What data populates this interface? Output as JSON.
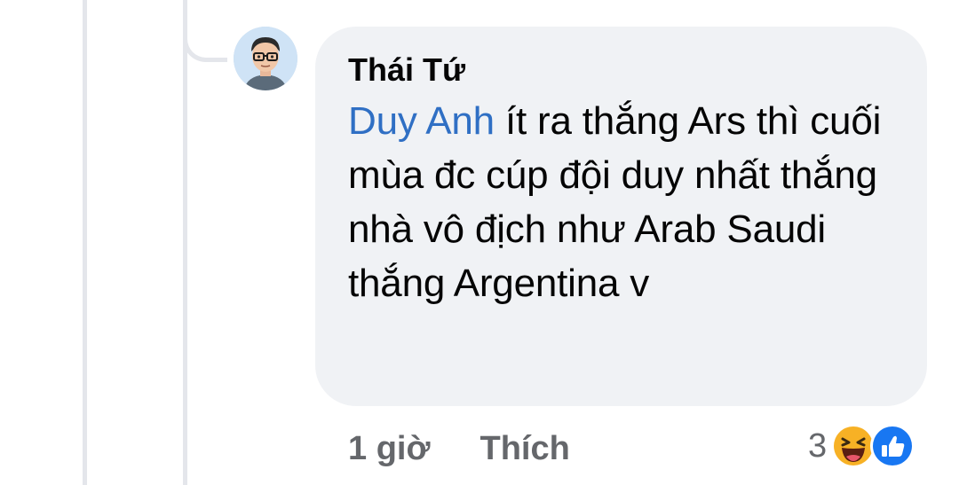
{
  "comment": {
    "author": "Thái Tứ",
    "mention": "Duy Anh",
    "text": " ít ra thắng Ars thì cuối mùa đc cúp đội duy nhất thắng nhà vô địch như Arab Saudi thắng Argentina v",
    "time": "1 giờ",
    "like_label": "Thích",
    "reaction_count": "3",
    "reaction_icons": [
      "haha-icon",
      "like-icon"
    ]
  },
  "colors": {
    "bubble": "#f0f2f5",
    "mention": "#2f6fc4",
    "meta_text": "#65676b",
    "like_blue": "#1877f2",
    "haha_yellow": "#f7b125"
  }
}
